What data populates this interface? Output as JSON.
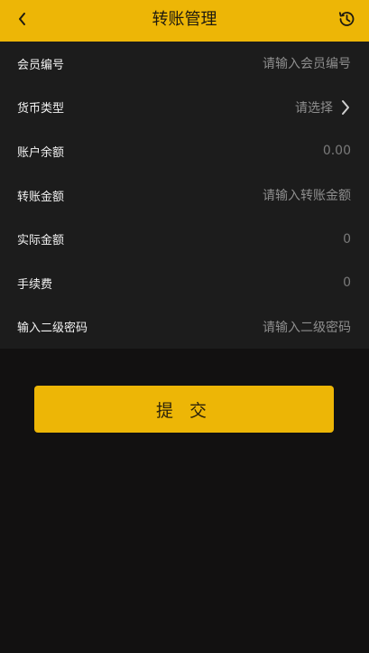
{
  "header": {
    "title": "转账管理"
  },
  "form": {
    "rows": [
      {
        "label": "会员编号",
        "value": "请输入会员编号"
      },
      {
        "label": "货币类型",
        "value": "请选择"
      },
      {
        "label": "账户余额",
        "value": "0.00"
      },
      {
        "label": "转账金额",
        "value": "请输入转账金额"
      },
      {
        "label": "实际金额",
        "value": "0"
      },
      {
        "label": "手续费",
        "value": "0"
      },
      {
        "label": "输入二级密码",
        "value": "请输入二级密码"
      }
    ]
  },
  "submit": {
    "label": "提 交"
  },
  "colors": {
    "accent": "#EDB606",
    "background": "#121111",
    "panel": "#1C1C1C"
  },
  "icons": {
    "back": "chevron-left-icon",
    "history": "history-icon",
    "select": "chevron-right-icon"
  }
}
